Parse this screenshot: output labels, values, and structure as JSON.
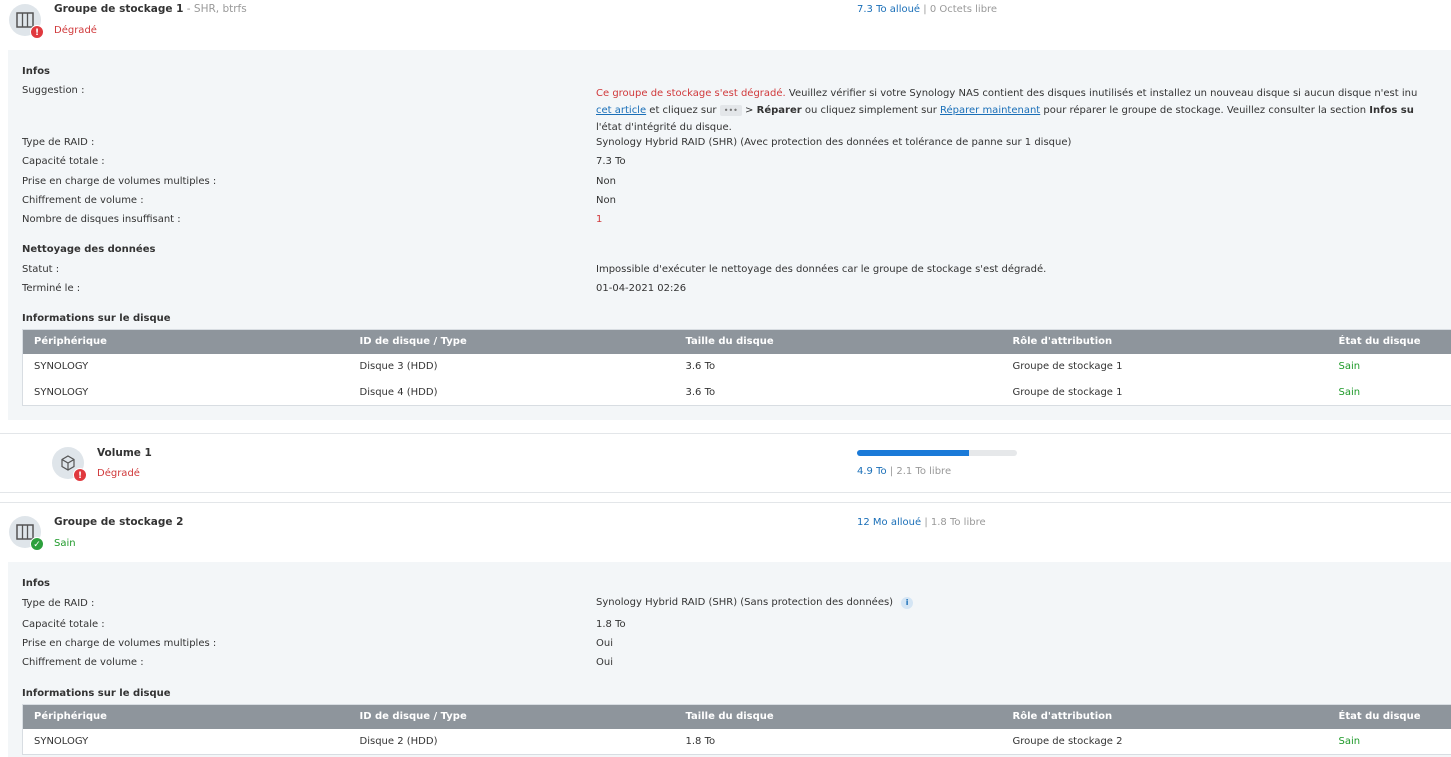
{
  "pool1": {
    "title": "Groupe de stockage 1",
    "subtitle": " - SHR, btrfs",
    "status": "Dégradé",
    "allocated": "7.3 To alloué",
    "free": "0 Octets libre",
    "infos_heading": "Infos",
    "suggestion_label": "Suggestion :",
    "suggestion": {
      "warn": "Ce groupe de stockage s'est dégradé.",
      "t1": " Veuillez vérifier si votre Synology NAS contient des disques inutilisés et installez un nouveau disque si aucun disque n'est inu",
      "link1": "cet article",
      "t2": " et cliquez sur ",
      "dots": "•••",
      "t3": " > ",
      "bold1": "Réparer",
      "t4": " ou cliquez simplement sur ",
      "link2": "Réparer maintenant",
      "t5": " pour réparer le groupe de stockage. Veuillez consulter la section ",
      "bold2": "Infos su",
      "t6": "l'état d'intégrité du disque."
    },
    "rows": [
      {
        "label": "Type de RAID :",
        "value": "Synology Hybrid RAID (SHR) (Avec protection des données et tolérance de panne sur 1 disque)"
      },
      {
        "label": "Capacité totale :",
        "value": "7.3 To"
      },
      {
        "label": "Prise en charge de volumes multiples :",
        "value": "Non"
      },
      {
        "label": "Chiffrement de volume :",
        "value": "Non"
      },
      {
        "label": "Nombre de disques insuffisant :",
        "value": "1"
      }
    ],
    "scrub_heading": "Nettoyage des données",
    "scrub": [
      {
        "label": "Statut :",
        "value": "Impossible d'exécuter le nettoyage des données car le groupe de stockage s'est dégradé."
      },
      {
        "label": "Terminé le :",
        "value": "01-04-2021 02:26"
      }
    ],
    "disk_heading": "Informations sur le disque",
    "disks": [
      [
        "SYNOLOGY",
        "Disque 3 (HDD)",
        "3.6 To",
        "Groupe de stockage 1",
        "Sain"
      ],
      [
        "SYNOLOGY",
        "Disque 4 (HDD)",
        "3.6 To",
        "Groupe de stockage 1",
        "Sain"
      ]
    ]
  },
  "columns": [
    "Périphérique",
    "ID de disque / Type",
    "Taille du disque",
    "Rôle d'attribution",
    "État du disque"
  ],
  "volume": {
    "title": "Volume 1",
    "status": "Dégradé",
    "used": "4.9 To",
    "free": "2.1 To libre",
    "usage_percent": 70
  },
  "pool2": {
    "title": "Groupe de stockage 2",
    "status": "Sain",
    "allocated": "12 Mo alloué",
    "free": "1.8 To libre",
    "infos_heading": "Infos",
    "rows": [
      {
        "label": "Type de RAID :",
        "value": "Synology Hybrid RAID (SHR) (Sans protection des données)"
      },
      {
        "label": "Capacité totale :",
        "value": "1.8 To"
      },
      {
        "label": "Prise en charge de volumes multiples :",
        "value": "Oui"
      },
      {
        "label": "Chiffrement de volume :",
        "value": "Oui"
      }
    ],
    "info_icon": "i",
    "disk_heading": "Informations sur le disque",
    "disks": [
      [
        "SYNOLOGY",
        "Disque 2 (HDD)",
        "1.8 To",
        "Groupe de stockage 2",
        "Sain"
      ]
    ]
  },
  "colors": {
    "degraded": "#d0393b",
    "healthy": "#1f9a2a",
    "accent": "#1a7ad8"
  }
}
